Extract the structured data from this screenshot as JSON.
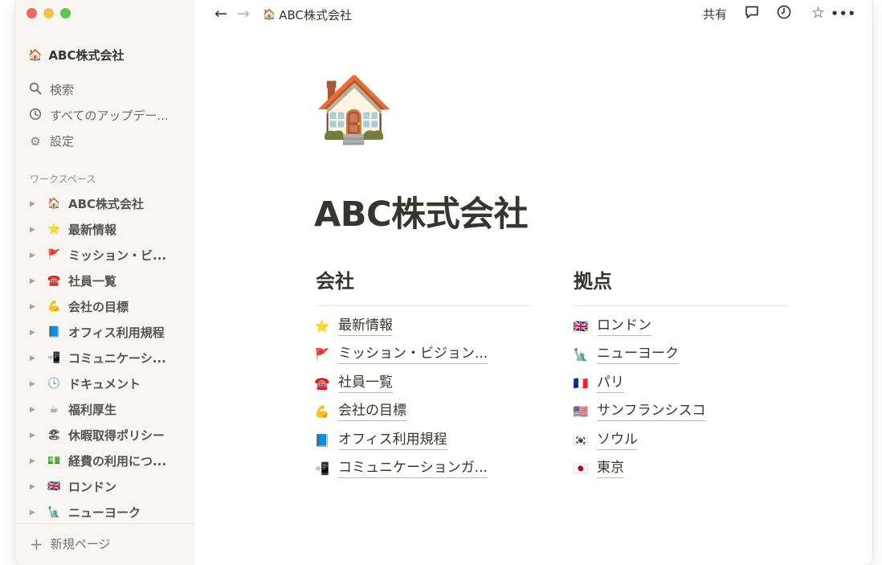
{
  "breadcrumb": {
    "icon": "🏠",
    "title": "ABC株式会社"
  },
  "topbar": {
    "share_label": "共有",
    "back_icon": "←",
    "forward_icon": "→",
    "comment_icon": "💬",
    "history_icon": "🕘",
    "favorite_icon": "☆",
    "more_icon": "•••"
  },
  "sidebar": {
    "workspace": {
      "icon": "🏠",
      "name": "ABC株式会社"
    },
    "nav": [
      {
        "icon": "🔍",
        "label": "検索"
      },
      {
        "icon": "🕘",
        "label": "すべてのアップデー..."
      },
      {
        "icon": "⚙",
        "label": "設定"
      }
    ],
    "section_label": "ワークスペース",
    "tree": [
      {
        "icon": "🏠",
        "label": "ABC株式会社"
      },
      {
        "icon": "⭐",
        "label": "最新情報"
      },
      {
        "icon": "🚩",
        "label": "ミッション・ビ..."
      },
      {
        "icon": "☎️",
        "label": "社員一覧"
      },
      {
        "icon": "💪",
        "label": "会社の目標"
      },
      {
        "icon": "📘",
        "label": "オフィス利用規程"
      },
      {
        "icon": "📲",
        "label": "コミュニケーシ..."
      },
      {
        "icon": "🕓",
        "label": "ドキュメント"
      },
      {
        "icon": "☕",
        "label": "福利厚生"
      },
      {
        "icon": "🏖",
        "label": "休暇取得ポリシー"
      },
      {
        "icon": "💵",
        "label": "経費の利用につ..."
      },
      {
        "icon": "🇬🇧",
        "label": "ロンドン"
      },
      {
        "icon": "🗽",
        "label": "ニューヨーク"
      }
    ],
    "new_page_icon": "+",
    "new_page_label": "新規ページ"
  },
  "page": {
    "icon": "🏠",
    "title": "ABC株式会社",
    "columns": [
      {
        "heading": "会社",
        "links": [
          {
            "icon": "⭐",
            "label": "最新情報"
          },
          {
            "icon": "🚩",
            "label": "ミッション・ビジョン..."
          },
          {
            "icon": "☎️",
            "label": "社員一覧"
          },
          {
            "icon": "💪",
            "label": "会社の目標"
          },
          {
            "icon": "📘",
            "label": "オフィス利用規程"
          },
          {
            "icon": "📲",
            "label": "コミュニケーションガ..."
          }
        ]
      },
      {
        "heading": "拠点",
        "links": [
          {
            "icon": "🇬🇧",
            "label": "ロンドン"
          },
          {
            "icon": "🗽",
            "label": "ニューヨーク"
          },
          {
            "icon": "🇫🇷",
            "label": "パリ"
          },
          {
            "icon": "🇺🇸",
            "label": "サンフランシスコ"
          },
          {
            "icon": "🇰🇷",
            "label": "ソウル"
          },
          {
            "icon": "🇯🇵",
            "label": "東京"
          }
        ]
      }
    ]
  }
}
